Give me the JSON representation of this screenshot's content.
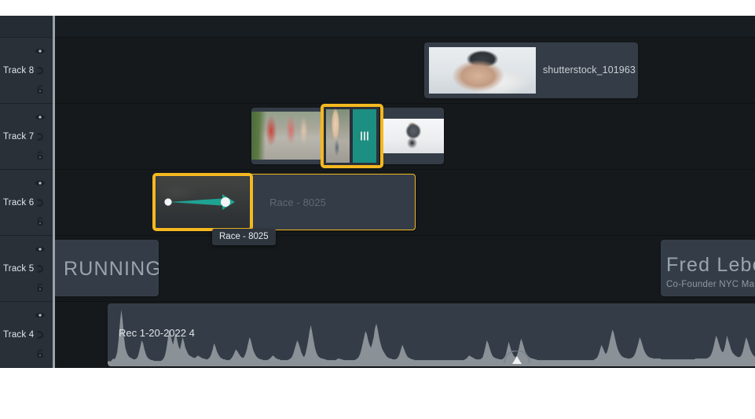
{
  "app": {
    "panel_name": "timeline-panel",
    "colors": {
      "panel_bg": "#15191c",
      "header_bg": "#2a3038",
      "clip_bg": "#343d47",
      "selection": "#f5b820",
      "transition": "#1c8f82",
      "waveform": "#9aa0a6",
      "text_primary": "#e2e6ea",
      "text_muted": "#9aa4ae"
    }
  },
  "track_headers": {
    "icon_names": [
      "eye-icon",
      "mute-icon",
      "lock-icon"
    ],
    "tracks": [
      {
        "label": "Track 8"
      },
      {
        "label": "Track 7"
      },
      {
        "label": "Track 6"
      },
      {
        "label": "Track 5"
      },
      {
        "label": "Track 4"
      }
    ]
  },
  "tracks": {
    "track8": {
      "label": "Track 8",
      "clips": [
        {
          "name": "shutterstock-clip",
          "title": "shutterstock_101963",
          "thumb": "athlete"
        }
      ]
    },
    "track7": {
      "label": "Track 7",
      "clips": [
        {
          "name": "marathon-feet-clip",
          "title": "",
          "thumb": "feet"
        },
        {
          "name": "runner-white-clip",
          "title": "",
          "thumb": "runner-white"
        }
      ],
      "transition": {
        "name": "transition-element",
        "selected": true,
        "grip_bars": 3
      }
    },
    "track6": {
      "label": "Track 6",
      "clips": [
        {
          "name": "race-clip",
          "title": "Race - 8025",
          "thumb": "race-dark"
        }
      ],
      "dragged_thumb": {
        "name": "dragged-clip-thumbnail",
        "selected": true,
        "motion_path": "pan-arrow"
      },
      "tooltip": {
        "name": "clip-tooltip",
        "text": "Race - 8025"
      }
    },
    "track5": {
      "label": "Track 5",
      "clips": [
        {
          "name": "running-title-clip",
          "title": "RUNNING"
        },
        {
          "name": "fred-lebow-title-clip",
          "title": "Fred Lebow",
          "subtitle": "Co-Founder NYC Marath"
        }
      ]
    },
    "track4": {
      "label": "Track 4",
      "clips": [
        {
          "name": "audio-recording-clip",
          "title": "Rec 1-20-2022 4",
          "type": "audio"
        }
      ]
    }
  },
  "chart_data": {
    "type": "area",
    "title": "Rec 1-20-2022 4",
    "xlabel": "",
    "ylabel": "",
    "grid": false,
    "legend": null,
    "note": "audio waveform amplitude envelope sampled across the audio clip",
    "values": [
      2,
      3,
      2,
      4,
      6,
      5,
      8,
      14,
      30,
      52,
      70,
      56,
      34,
      20,
      14,
      10,
      8,
      7,
      6,
      5,
      5,
      6,
      8,
      14,
      22,
      30,
      26,
      18,
      12,
      8,
      6,
      5,
      4,
      4,
      3,
      3,
      3,
      3,
      3,
      3,
      4,
      6,
      10,
      18,
      30,
      44,
      38,
      30,
      24,
      34,
      40,
      30,
      22,
      18,
      26,
      34,
      28,
      20,
      16,
      12,
      10,
      9,
      8,
      7,
      7,
      8,
      10,
      9,
      8,
      7,
      6,
      6,
      5,
      5,
      6,
      8,
      12,
      18,
      26,
      22,
      16,
      12,
      9,
      7,
      6,
      5,
      5,
      4,
      4,
      4,
      5,
      7,
      10,
      14,
      18,
      16,
      13,
      10,
      8,
      7,
      8,
      12,
      18,
      26,
      34,
      30,
      22,
      16,
      12,
      9,
      7,
      6,
      5,
      5,
      4,
      4,
      4,
      4,
      5,
      6,
      8,
      10,
      9,
      7,
      6,
      5,
      5,
      4,
      4,
      4,
      4,
      4,
      4,
      5,
      6,
      8,
      12,
      18,
      24,
      30,
      26,
      20,
      14,
      10,
      8,
      12,
      20,
      30,
      42,
      50,
      40,
      30,
      20,
      14,
      10,
      8,
      7,
      6,
      6,
      5,
      5,
      4,
      4,
      4,
      4,
      4,
      4,
      4,
      5,
      6,
      6,
      5,
      5,
      4,
      4,
      4,
      4,
      4,
      4,
      4,
      4,
      4,
      5,
      6,
      8,
      12,
      18,
      26,
      34,
      42,
      38,
      30,
      24,
      20,
      26,
      34,
      46,
      52,
      44,
      34,
      26,
      20,
      16,
      13,
      10,
      8,
      7,
      6,
      6,
      5,
      5,
      5,
      6,
      8,
      12,
      18,
      24,
      20,
      15,
      11,
      8,
      7,
      6,
      5,
      5,
      4,
      4,
      4,
      4,
      4,
      4,
      4,
      4,
      4,
      4,
      4,
      4,
      4,
      4,
      4,
      4,
      4,
      4,
      4,
      4,
      4,
      4,
      4,
      4,
      4,
      4,
      4,
      4,
      4,
      4,
      4,
      4,
      4,
      4,
      4,
      4,
      4,
      5,
      6,
      8,
      10,
      9,
      8,
      7,
      6,
      5,
      5,
      5,
      5,
      6,
      8,
      14,
      22,
      30,
      26,
      20,
      14,
      10,
      8,
      7,
      6,
      6,
      5,
      5,
      5,
      6,
      8,
      12,
      20,
      28,
      22,
      16,
      12,
      9,
      8,
      10,
      16,
      24,
      32,
      28,
      22,
      16,
      12,
      10,
      8,
      7,
      6,
      6,
      5,
      5,
      4,
      4,
      4,
      4,
      4,
      4,
      4,
      4,
      4,
      4,
      4,
      4,
      4,
      4,
      4,
      4,
      4,
      4,
      4,
      4,
      4,
      4,
      4,
      4,
      4,
      4,
      4,
      4,
      4,
      4,
      4,
      4,
      4,
      4,
      4,
      4,
      4,
      4,
      4,
      4,
      4,
      4,
      5,
      6,
      8,
      12,
      18,
      24,
      20,
      16,
      12,
      14,
      20,
      28,
      36,
      44,
      40,
      32,
      24,
      18,
      14,
      11,
      9,
      8,
      7,
      7,
      6,
      6,
      6,
      7,
      8,
      10,
      14,
      20,
      26,
      34,
      30,
      24,
      18,
      14,
      11,
      9,
      8,
      7,
      7,
      6,
      6,
      6,
      6,
      6,
      6,
      5,
      5,
      5,
      5,
      5,
      5,
      5,
      5,
      5,
      5,
      5,
      5,
      5,
      5,
      5,
      5,
      5,
      5,
      5,
      5,
      5,
      5,
      5,
      5,
      5,
      6,
      6,
      6,
      6,
      6,
      6,
      6,
      6,
      6,
      7,
      8,
      10,
      14,
      20,
      28,
      36,
      32,
      26,
      20,
      16,
      14,
      18,
      26,
      36,
      30,
      24,
      18,
      14,
      12,
      10,
      9,
      8,
      8,
      9,
      12,
      18,
      26,
      34,
      30,
      24,
      18,
      14,
      11,
      9,
      8,
      8,
      8,
      9
    ],
    "ylim": [
      0,
      72
    ]
  }
}
